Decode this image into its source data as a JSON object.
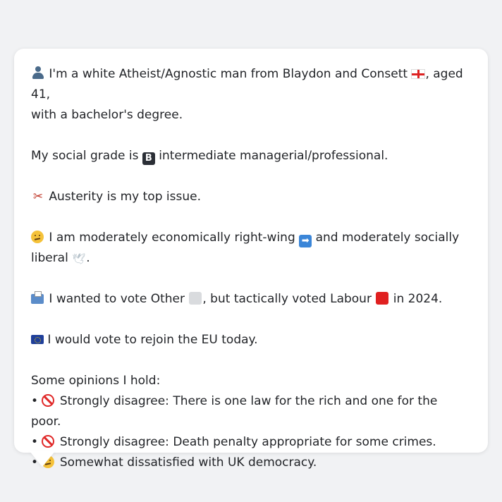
{
  "profile": {
    "line1_a": "I'm a white Atheist/Agnostic man from Blaydon and Consett",
    "line1_b": ", aged 41,",
    "line1_c": "with a bachelor's degree.",
    "grade_pre": "My social grade is",
    "grade_badge": "B",
    "grade_post": "intermediate managerial/professional.",
    "issue_icon": "✂",
    "issue_text": "Austerity is my top issue.",
    "politics_a": "I am moderately economically right-wing",
    "politics_b": "and moderately socially",
    "politics_c": "liberal",
    "politics_dove": "🕊",
    "politics_end": ".",
    "vote_a": "I wanted to vote Other",
    "vote_b": ", but tactically voted Labour",
    "vote_c": "in 2024.",
    "eu_text": "I would vote to rejoin the EU today.",
    "opinions_heading": "Some opinions I hold:",
    "bullet": "•",
    "opinions": [
      "Strongly disagree: There is one law for the rich and one for the poor.",
      "Strongly disagree: Death penalty appropriate for some crimes.",
      "Somewhat dissatisfied with UK democracy."
    ],
    "arrow_glyph": "➡"
  },
  "colors": {
    "background": "#f1f2f4",
    "bubble": "#ffffff",
    "text": "#222428",
    "labour_red": "#e02020",
    "other_gray": "#d9dbde"
  }
}
